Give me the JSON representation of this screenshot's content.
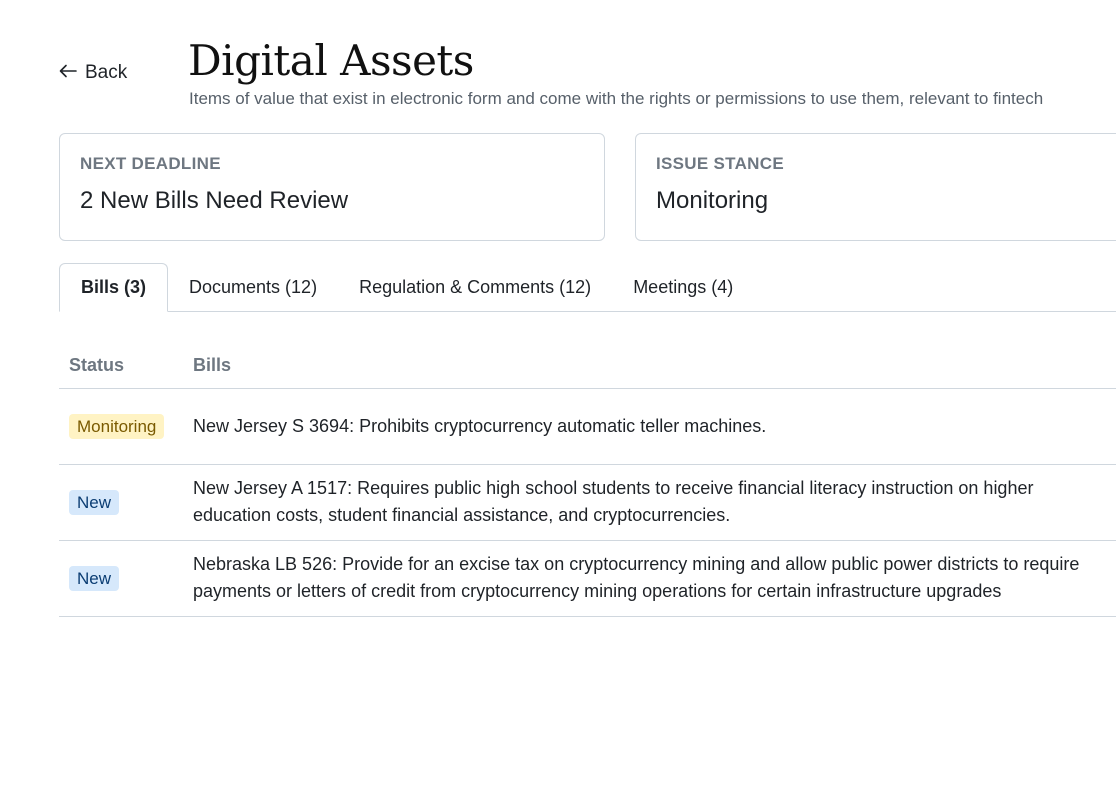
{
  "header": {
    "back_label": "Back",
    "title": "Digital Assets",
    "subtitle": "Items of value that exist in electronic form and come with the rights or permissions to use them, relevant to fintech"
  },
  "cards": {
    "deadline": {
      "label": "NEXT DEADLINE",
      "value": "2 New Bills Need Review"
    },
    "stance": {
      "label": "ISSUE STANCE",
      "value": "Monitoring"
    }
  },
  "tabs": [
    {
      "label": "Bills (3)",
      "active": true
    },
    {
      "label": "Documents (12)",
      "active": false
    },
    {
      "label": "Regulation & Comments (12)",
      "active": false
    },
    {
      "label": "Meetings (4)",
      "active": false
    }
  ],
  "table": {
    "headers": {
      "status": "Status",
      "bills": "Bills"
    },
    "rows": [
      {
        "status": "Monitoring",
        "bill": "New Jersey S 3694: Prohibits cryptocurrency automatic teller machines."
      },
      {
        "status": "New",
        "bill": "New Jersey A 1517: Requires public high school students to receive financial literacy instruction on higher education costs, student financial assistance, and cryptocurrencies."
      },
      {
        "status": "New",
        "bill": "Nebraska LB 526: Provide for an excise tax on cryptocurrency mining and allow public power districts to require payments or letters of credit from cryptocurrency mining operations for certain infrastructure upgrades"
      }
    ]
  },
  "colors": {
    "monitoring_badge_bg": "#fff3c4",
    "new_badge_bg": "#d6e8fb",
    "border": "#d0d7de"
  }
}
